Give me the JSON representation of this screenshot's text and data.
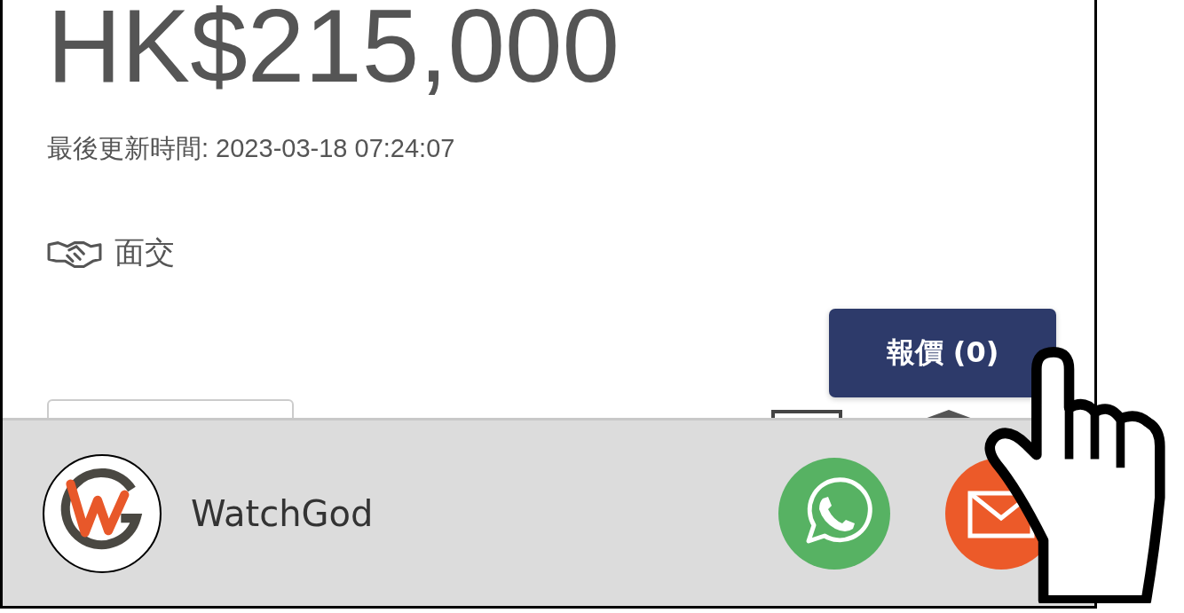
{
  "listing": {
    "price": "HK$215,000",
    "last_updated": "最後更新時間: 2023-03-18 07:24:07",
    "trade_method": "面交",
    "quote_button": "報價 (0)"
  },
  "footer": {
    "seller_name": "WatchGod"
  }
}
